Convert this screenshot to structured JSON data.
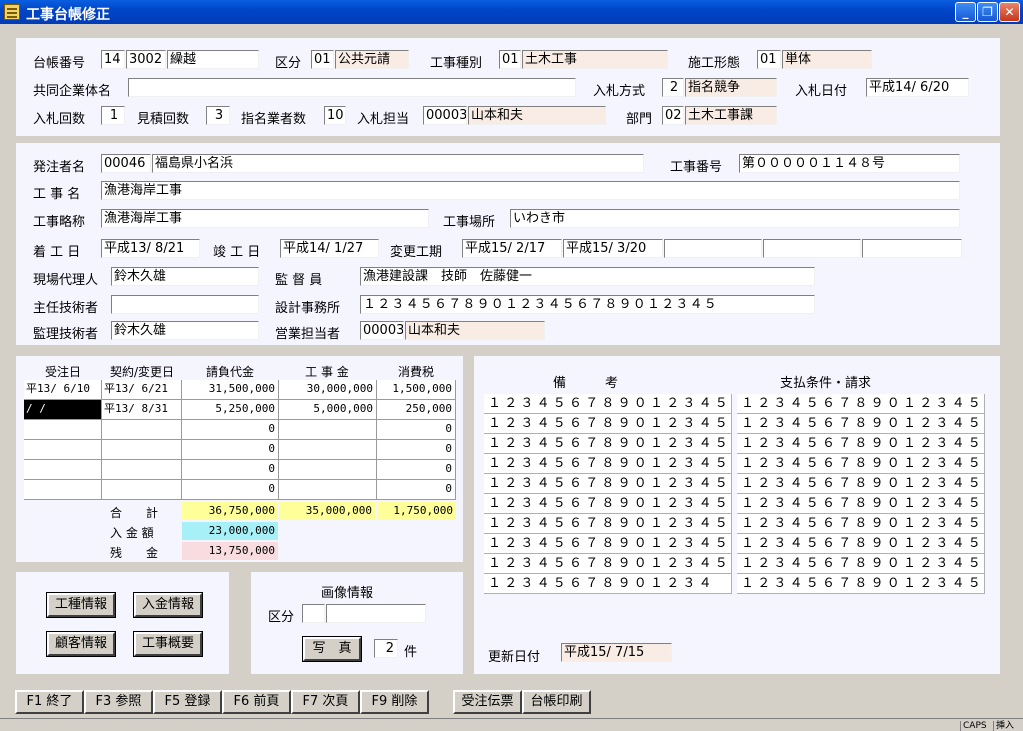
{
  "window": {
    "title": "工事台帳修正",
    "min": "_",
    "max": "❐",
    "close": "✕"
  },
  "header": {
    "daicho_label": "台帳番号",
    "daicho_no1": "14",
    "daicho_no2": "3002",
    "daicho_name": "繰越",
    "kubun_label": "区分",
    "kubun_code": "01",
    "kubun_name": "公共元請",
    "koji_shubetsu_label": "工事種別",
    "koji_shubetsu_code": "01",
    "koji_shubetsu_name": "土木工事",
    "sekou_label": "施工形態",
    "sekou_code": "01",
    "sekou_name": "単体",
    "kyodo_label": "共同企業体名",
    "kyodo_value": "",
    "nyusatsu_hoshiki_label": "入札方式",
    "nyusatsu_hoshiki_code": "2",
    "nyusatsu_hoshiki_name": "指名競争",
    "nyusatsu_date_label": "入札日付",
    "nyusatsu_date": "平成14/ 6/20",
    "nyusatsu_kaisu_label": "入札回数",
    "nyusatsu_kaisu": "1",
    "mitsumori_label": "見積回数",
    "mitsumori": "3",
    "shimei_label": "指名業者数",
    "shimei": "10",
    "tanto_label": "入札担当",
    "tanto_code": "00003",
    "tanto_name": "山本和夫",
    "bumon_label": "部門",
    "bumon_code": "02",
    "bumon_name": "土木工事課"
  },
  "detail": {
    "hacchu_label": "発注者名",
    "hacchu_code": "00046",
    "hacchu_name": "福島県小名浜",
    "koji_no_label": "工事番号",
    "koji_no": "第０００００１１４８号",
    "koji_mei_label": "工 事 名",
    "koji_mei": "漁港海岸工事",
    "ryaku_label": "工事略称",
    "ryaku": "漁港海岸工事",
    "basho_label": "工事場所",
    "basho": "いわき市",
    "chakko_label": "着 工 日",
    "chakko": "平成13/ 8/21",
    "shunko_label": "竣 工 日",
    "shunko": "平成14/ 1/27",
    "henko_label": "変更工期",
    "henko1": "平成15/ 2/17",
    "henko2": "平成15/ 3/20",
    "henko3": "",
    "henko4": "",
    "genba_label": "現場代理人",
    "genba": "鈴木久雄",
    "kantoku_label": "監 督 員",
    "kantoku": "漁港建設課　技師　佐藤健一",
    "shunin_label": "主任技術者",
    "shunin": "",
    "sekkei_label": "設計事務所",
    "sekkei": "１２３４５６７８９０１２３４５６７８９０１２３４５",
    "kanri_label": "監理技術者",
    "kanri": "鈴木久雄",
    "eigyo_label": "営業担当者",
    "eigyo_code": "00003",
    "eigyo_name": "山本和夫"
  },
  "contracts": {
    "headers": [
      "受注日",
      "契約/変更日",
      "請負代金",
      "工 事 金",
      "消費税"
    ],
    "rows": [
      [
        "平13/ 6/10",
        "平13/ 6/21",
        "31,500,000",
        "30,000,000",
        "1,500,000"
      ],
      [
        "  /  /",
        "平13/ 8/31",
        "5,250,000",
        "5,000,000",
        "250,000"
      ],
      [
        "",
        "",
        "0",
        "",
        "0"
      ],
      [
        "",
        "",
        "0",
        "",
        "0"
      ],
      [
        "",
        "",
        "0",
        "",
        "0"
      ],
      [
        "",
        "",
        "0",
        "",
        "0"
      ]
    ],
    "total_label": "合　　計",
    "total_ukeoi": "36,750,000",
    "total_koji": "35,000,000",
    "total_tax": "1,750,000",
    "nyukin_label": "入 金 額",
    "nyukin": "23,000,000",
    "zankin_label": "残　　金",
    "zankin": "13,750,000"
  },
  "remarks": {
    "biko_label": "備　　　考",
    "shiharai_label": "支払条件・請求",
    "biko": [
      "１２３４５６７８９０１２３４５",
      "１２３４５６７８９０１２３４５",
      "１２３４５６７８９０１２３４５",
      "１２３４５６７８９０１２３４５",
      "１２３４５６７８９０１２３４５",
      "１２３４５６７８９０１２３４５",
      "１２３４５６７８９０１２３４５",
      "１２３４５６７８９０１２３４５",
      "１２３４５６７８９０１２３４５",
      "１２３４５６７８９０１２３４"
    ],
    "shiharai": [
      "１２３４５６７８９０１２３４５",
      "１２３４５６７８９０１２３４５",
      "１２３４５６７８９０１２３４５",
      "１２３４５６７８９０１２３４５",
      "１２３４５６７８９０１２３４５",
      "１２３４５６７８９０１２３４５",
      "１２３４５６７８９０１２３４５",
      "１２３４５６７８９０１２３４５",
      "１２３４５６７８９０１２３４５",
      "１２３４５６７８９０１２３４５"
    ],
    "koshin_label": "更新日付",
    "koshin": "平成15/ 7/15"
  },
  "info_buttons": {
    "koshu": "工種情報",
    "nyukin": "入金情報",
    "kokyaku": "顧客情報",
    "gaiyo": "工事概要"
  },
  "image": {
    "title": "画像情報",
    "kubun_label": "区分",
    "kubun_code": "",
    "kubun_name": "",
    "photo": "写　真",
    "count": "2",
    "count_unit": "件"
  },
  "fkeys": [
    "F1 終了",
    "F3 参照",
    "F5 登録",
    "F6 前頁",
    "F7 次頁",
    "F9 削除",
    "受注伝票",
    "台帳印刷"
  ],
  "status": {
    "caps": "CAPS",
    "insert": "挿入"
  }
}
